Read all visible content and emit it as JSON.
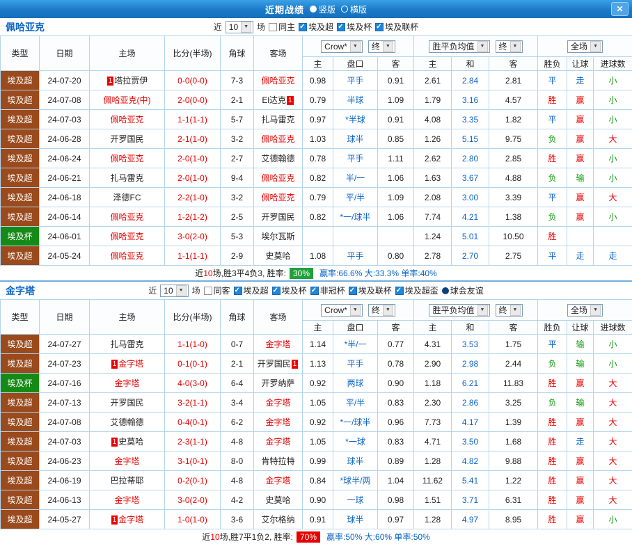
{
  "titlebar": {
    "title": "近期战绩",
    "layout_options": [
      {
        "label": "竖版",
        "selected": true
      },
      {
        "label": "横版",
        "selected": false
      }
    ],
    "close_label": "✕"
  },
  "table_headers": {
    "main": [
      "类型",
      "日期",
      "主场",
      "比分(半场)",
      "角球",
      "客场"
    ],
    "selects": {
      "company": "Crow*",
      "final": "终",
      "avg": "胜平负均值",
      "final2": "终",
      "scope": "全场"
    },
    "sub": [
      "主",
      "盘口",
      "客",
      "主",
      "和",
      "客",
      "胜负",
      "让球",
      "进球数"
    ]
  },
  "colors": {
    "league": {
      "埃及超": "#9a4a1c",
      "埃及杯": "#168a16"
    },
    "result": {
      "胜": "#e60000",
      "平": "#0a64c8",
      "负": "#0c9a0c"
    },
    "handicap_result": {
      "赢": "#e60000",
      "走": "#0a64c8",
      "输": "#0c9a0c"
    },
    "goals": {
      "大": "#e60000",
      "小": "#0c9a0c",
      "走": "#0a64c8"
    }
  },
  "sections": [
    {
      "team": "佩哈亚克",
      "filters": {
        "near_label": "近",
        "count": "10",
        "games_label": "场",
        "same": {
          "label": "同主",
          "checked": false
        },
        "leagues": [
          {
            "label": "埃及超",
            "checked": true
          },
          {
            "label": "埃及杯",
            "checked": true
          },
          {
            "label": "埃及联杯",
            "checked": true
          }
        ]
      },
      "rows": [
        {
          "league": "埃及超",
          "date": "24-07-20",
          "home": {
            "name": "塔拉贾伊",
            "red": false,
            "badge": "1"
          },
          "score": "0-0(0-0)",
          "corners": "7-3",
          "away": {
            "name": "佩哈亚克",
            "red": true,
            "badge": ""
          },
          "odds_home": "0.98",
          "handicap": "平手",
          "odds_away": "0.91",
          "avg_home": "2.61",
          "avg_draw": "2.84",
          "avg_away": "2.81",
          "result": "平",
          "handicap_result": "走",
          "goals": "小"
        },
        {
          "league": "埃及超",
          "date": "24-07-08",
          "home": {
            "name": "佩哈亚克(中)",
            "red": true,
            "badge": ""
          },
          "score": "2-0(0-0)",
          "corners": "2-1",
          "away": {
            "name": "El达克",
            "red": false,
            "badge": "1"
          },
          "odds_home": "0.79",
          "handicap": "半球",
          "odds_away": "1.09",
          "avg_home": "1.79",
          "avg_draw": "3.16",
          "avg_away": "4.57",
          "result": "胜",
          "handicap_result": "赢",
          "goals": "小"
        },
        {
          "league": "埃及超",
          "date": "24-07-03",
          "home": {
            "name": "佩哈亚克",
            "red": true,
            "badge": ""
          },
          "score": "1-1(1-1)",
          "corners": "5-7",
          "away": {
            "name": "扎马雷克",
            "red": false,
            "badge": ""
          },
          "odds_home": "0.97",
          "handicap": "*半球",
          "odds_away": "0.91",
          "avg_home": "4.08",
          "avg_draw": "3.35",
          "avg_away": "1.82",
          "result": "平",
          "handicap_result": "赢",
          "goals": "小"
        },
        {
          "league": "埃及超",
          "date": "24-06-28",
          "home": {
            "name": "开罗国民",
            "red": false,
            "badge": ""
          },
          "score": "2-1(1-0)",
          "corners": "3-2",
          "away": {
            "name": "佩哈亚克",
            "red": true,
            "badge": ""
          },
          "odds_home": "1.03",
          "handicap": "球半",
          "odds_away": "0.85",
          "avg_home": "1.26",
          "avg_draw": "5.15",
          "avg_away": "9.75",
          "result": "负",
          "handicap_result": "赢",
          "goals": "大"
        },
        {
          "league": "埃及超",
          "date": "24-06-24",
          "home": {
            "name": "佩哈亚克",
            "red": true,
            "badge": ""
          },
          "score": "2-0(1-0)",
          "corners": "2-7",
          "away": {
            "name": "艾德翰德",
            "red": false,
            "badge": ""
          },
          "odds_home": "0.78",
          "handicap": "平手",
          "odds_away": "1.11",
          "avg_home": "2.62",
          "avg_draw": "2.80",
          "avg_away": "2.85",
          "result": "胜",
          "handicap_result": "赢",
          "goals": "小"
        },
        {
          "league": "埃及超",
          "date": "24-06-21",
          "home": {
            "name": "扎马雷克",
            "red": false,
            "badge": ""
          },
          "score": "2-0(1-0)",
          "corners": "9-4",
          "away": {
            "name": "佩哈亚克",
            "red": true,
            "badge": ""
          },
          "odds_home": "0.82",
          "handicap": "半/一",
          "odds_away": "1.06",
          "avg_home": "1.63",
          "avg_draw": "3.67",
          "avg_away": "4.88",
          "result": "负",
          "handicap_result": "输",
          "goals": "小"
        },
        {
          "league": "埃及超",
          "date": "24-06-18",
          "home": {
            "name": "泽德FC",
            "red": false,
            "badge": ""
          },
          "score": "2-2(1-0)",
          "corners": "3-2",
          "away": {
            "name": "佩哈亚克",
            "red": true,
            "badge": ""
          },
          "odds_home": "0.79",
          "handicap": "平/半",
          "odds_away": "1.09",
          "avg_home": "2.08",
          "avg_draw": "3.00",
          "avg_away": "3.39",
          "result": "平",
          "handicap_result": "赢",
          "goals": "大"
        },
        {
          "league": "埃及超",
          "date": "24-06-14",
          "home": {
            "name": "佩哈亚克",
            "red": true,
            "badge": ""
          },
          "score": "1-2(1-2)",
          "corners": "2-5",
          "away": {
            "name": "开罗国民",
            "red": false,
            "badge": ""
          },
          "odds_home": "0.82",
          "handicap": "*一/球半",
          "odds_away": "1.06",
          "avg_home": "7.74",
          "avg_draw": "4.21",
          "avg_away": "1.38",
          "result": "负",
          "handicap_result": "赢",
          "goals": "小"
        },
        {
          "league": "埃及杯",
          "date": "24-06-01",
          "home": {
            "name": "佩哈亚克",
            "red": true,
            "badge": ""
          },
          "score": "3-0(2-0)",
          "corners": "5-3",
          "away": {
            "name": "埃尔瓦斯",
            "red": false,
            "badge": ""
          },
          "odds_home": "",
          "handicap": "",
          "odds_away": "",
          "avg_home": "1.24",
          "avg_draw": "5.01",
          "avg_away": "10.50",
          "result": "胜",
          "handicap_result": "",
          "goals": ""
        },
        {
          "league": "埃及超",
          "date": "24-05-24",
          "home": {
            "name": "佩哈亚克",
            "red": true,
            "badge": ""
          },
          "score": "1-1(1-1)",
          "corners": "2-9",
          "away": {
            "name": "史莫哈",
            "red": false,
            "badge": ""
          },
          "odds_home": "1.08",
          "handicap": "平手",
          "odds_away": "0.80",
          "avg_home": "2.78",
          "avg_draw": "2.70",
          "avg_away": "2.75",
          "result": "平",
          "handicap_result": "走",
          "goals": "走"
        }
      ],
      "summary": {
        "near": "近",
        "count": "10",
        "record": "场,胜3平4负3, 胜率:",
        "rate": "30%",
        "rate_color": "#21a13a",
        "stats": "赢率:66.6% 大:33.3% 单率:40%"
      }
    },
    {
      "team": "金字塔",
      "filters": {
        "near_label": "近",
        "count": "10",
        "games_label": "场",
        "same": {
          "label": "同客",
          "checked": false
        },
        "leagues": [
          {
            "label": "埃及超",
            "checked": true
          },
          {
            "label": "埃及杯",
            "checked": true
          },
          {
            "label": "非冠杯",
            "checked": true
          },
          {
            "label": "埃及联杯",
            "checked": true
          },
          {
            "label": "埃及超盃",
            "checked": true
          },
          {
            "label": "球会友谊",
            "checked": false,
            "style": "bullet"
          }
        ]
      },
      "rows": [
        {
          "league": "埃及超",
          "date": "24-07-27",
          "home": {
            "name": "扎马雷克",
            "red": false,
            "badge": ""
          },
          "score": "1-1(1-0)",
          "corners": "0-7",
          "away": {
            "name": "金字塔",
            "red": true,
            "badge": ""
          },
          "odds_home": "1.14",
          "handicap": "*半/一",
          "odds_away": "0.77",
          "avg_home": "4.31",
          "avg_draw": "3.53",
          "avg_away": "1.75",
          "result": "平",
          "handicap_result": "输",
          "goals": "小"
        },
        {
          "league": "埃及超",
          "date": "24-07-23",
          "home": {
            "name": "金字塔",
            "red": true,
            "badge": "1"
          },
          "score": "0-1(0-1)",
          "corners": "2-1",
          "away": {
            "name": "开罗国民",
            "red": false,
            "badge": "1"
          },
          "odds_home": "1.13",
          "handicap": "平手",
          "odds_away": "0.78",
          "avg_home": "2.90",
          "avg_draw": "2.98",
          "avg_away": "2.44",
          "result": "负",
          "handicap_result": "输",
          "goals": "小"
        },
        {
          "league": "埃及杯",
          "date": "24-07-16",
          "home": {
            "name": "金字塔",
            "red": true,
            "badge": ""
          },
          "score": "4-0(3-0)",
          "corners": "6-4",
          "away": {
            "name": "开罗纳萨",
            "red": false,
            "badge": ""
          },
          "odds_home": "0.92",
          "handicap": "两球",
          "odds_away": "0.90",
          "avg_home": "1.18",
          "avg_draw": "6.21",
          "avg_away": "11.83",
          "result": "胜",
          "handicap_result": "赢",
          "goals": "大"
        },
        {
          "league": "埃及超",
          "date": "24-07-13",
          "home": {
            "name": "开罗国民",
            "red": false,
            "badge": ""
          },
          "score": "3-2(1-1)",
          "corners": "3-4",
          "away": {
            "name": "金字塔",
            "red": true,
            "badge": ""
          },
          "odds_home": "1.05",
          "handicap": "平/半",
          "odds_away": "0.83",
          "avg_home": "2.30",
          "avg_draw": "2.86",
          "avg_away": "3.25",
          "result": "负",
          "handicap_result": "输",
          "goals": "大"
        },
        {
          "league": "埃及超",
          "date": "24-07-08",
          "home": {
            "name": "艾德翰德",
            "red": false,
            "badge": ""
          },
          "score": "0-4(0-1)",
          "corners": "6-2",
          "away": {
            "name": "金字塔",
            "red": true,
            "badge": ""
          },
          "odds_home": "0.92",
          "handicap": "*一/球半",
          "odds_away": "0.96",
          "avg_home": "7.73",
          "avg_draw": "4.17",
          "avg_away": "1.39",
          "result": "胜",
          "handicap_result": "赢",
          "goals": "大"
        },
        {
          "league": "埃及超",
          "date": "24-07-03",
          "home": {
            "name": "史莫哈",
            "red": false,
            "badge": "1"
          },
          "score": "2-3(1-1)",
          "corners": "4-8",
          "away": {
            "name": "金字塔",
            "red": true,
            "badge": ""
          },
          "odds_home": "1.05",
          "handicap": "*一球",
          "odds_away": "0.83",
          "avg_home": "4.71",
          "avg_draw": "3.50",
          "avg_away": "1.68",
          "result": "胜",
          "handicap_result": "走",
          "goals": "大"
        },
        {
          "league": "埃及超",
          "date": "24-06-23",
          "home": {
            "name": "金字塔",
            "red": true,
            "badge": ""
          },
          "score": "3-1(0-1)",
          "corners": "8-0",
          "away": {
            "name": "肯特拉特",
            "red": false,
            "badge": ""
          },
          "odds_home": "0.99",
          "handicap": "球半",
          "odds_away": "0.89",
          "avg_home": "1.28",
          "avg_draw": "4.82",
          "avg_away": "9.88",
          "result": "胜",
          "handicap_result": "赢",
          "goals": "大"
        },
        {
          "league": "埃及超",
          "date": "24-06-19",
          "home": {
            "name": "巴拉蒂耶",
            "red": false,
            "badge": ""
          },
          "score": "0-2(0-1)",
          "corners": "4-8",
          "away": {
            "name": "金字塔",
            "red": true,
            "badge": ""
          },
          "odds_home": "0.84",
          "handicap": "*球半/两",
          "odds_away": "1.04",
          "avg_home": "11.62",
          "avg_draw": "5.41",
          "avg_away": "1.22",
          "result": "胜",
          "handicap_result": "赢",
          "goals": "大"
        },
        {
          "league": "埃及超",
          "date": "24-06-13",
          "home": {
            "name": "金字塔",
            "red": true,
            "badge": ""
          },
          "score": "3-0(2-0)",
          "corners": "4-2",
          "away": {
            "name": "史莫哈",
            "red": false,
            "badge": ""
          },
          "odds_home": "0.90",
          "handicap": "一球",
          "odds_away": "0.98",
          "avg_home": "1.51",
          "avg_draw": "3.71",
          "avg_away": "6.31",
          "result": "胜",
          "handicap_result": "赢",
          "goals": "大"
        },
        {
          "league": "埃及超",
          "date": "24-05-27",
          "home": {
            "name": "金字塔",
            "red": true,
            "badge": "1"
          },
          "score": "1-0(1-0)",
          "corners": "3-6",
          "away": {
            "name": "艾尔格纳",
            "red": false,
            "badge": ""
          },
          "odds_home": "0.91",
          "handicap": "球半",
          "odds_away": "0.97",
          "avg_home": "1.28",
          "avg_draw": "4.97",
          "avg_away": "8.95",
          "result": "胜",
          "handicap_result": "赢",
          "goals": "小"
        }
      ],
      "summary": {
        "near": "近",
        "count": "10",
        "record": "场,胜7平1负2, 胜率:",
        "rate": "70%",
        "rate_color": "#e60000",
        "stats": "赢率:50% 大:60% 单率:50%"
      }
    }
  ]
}
